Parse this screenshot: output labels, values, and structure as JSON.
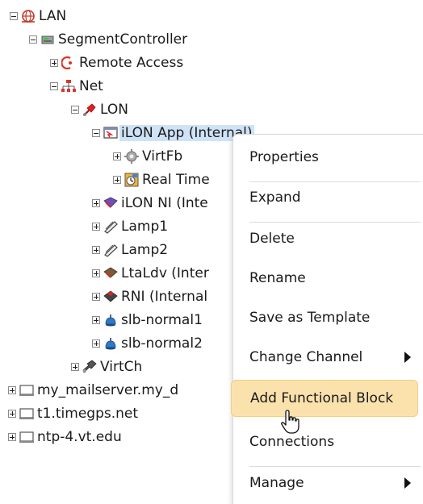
{
  "tree": {
    "lan": "LAN",
    "segment_controller": "SegmentController",
    "remote_access": "Remote Access",
    "net": "Net",
    "lon": "LON",
    "ilon_app": "iLON App (Internal)",
    "virtfb": "VirtFb",
    "real_time": "Real Time",
    "ilon_ni": "iLON NI (Inte",
    "lamp1": "Lamp1",
    "lamp2": "Lamp2",
    "ltaldv": "LtaLdv (Inter",
    "rni": "RNI (Internal",
    "slb1": "slb-normal1",
    "slb2": "slb-normal2",
    "virtch": "VirtCh",
    "mailserver": "my_mailserver.my_d",
    "timegps": "t1.timegps.net",
    "ntp": "ntp-4.vt.edu"
  },
  "menu": {
    "properties": "Properties",
    "expand": "Expand",
    "delete": "Delete",
    "rename": "Rename",
    "save_template": "Save as Template",
    "change_channel": "Change Channel",
    "add_block": "Add Functional Block",
    "connections": "Connections",
    "manage": "Manage"
  },
  "colors": {
    "selection": "#cfe3f7",
    "menu_highlight": "#fbe2ad"
  }
}
